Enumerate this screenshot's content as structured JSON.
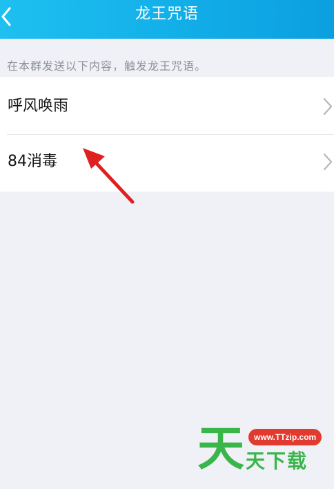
{
  "header": {
    "title": "龙王咒语",
    "back_icon": "chevron-left-icon"
  },
  "hint": "在本群发送以下内容，触发龙王咒语。",
  "items": [
    {
      "label": "呼风唤雨",
      "icon": "chevron-right-icon"
    },
    {
      "label": "84消毒",
      "icon": "chevron-right-icon"
    }
  ],
  "annotation": {
    "icon": "red-arrow-icon",
    "color": "#e02020"
  },
  "watermark": {
    "big_char": "天",
    "url": "www.TTzip.com",
    "text": "天下载"
  },
  "colors": {
    "header": "#12aee8",
    "background": "#f0f1f6",
    "watermark_green": "#39b54a",
    "watermark_red": "#e23a2e"
  }
}
